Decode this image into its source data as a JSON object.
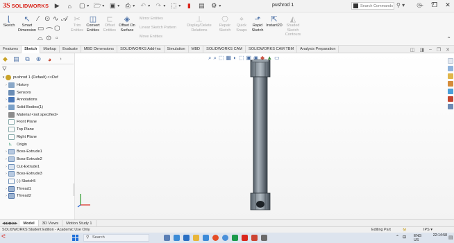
{
  "app": {
    "logo": {
      "mark": "3S",
      "name": "SOLIDWORKS",
      "mark_color": "#d9261c"
    },
    "document_title": "pushrod 1",
    "search_placeholder": "Search Commands"
  },
  "ribbon": {
    "sketch_label": "Sketch",
    "smart_dimension_label": "Smart Dimension",
    "trim_label": "Trim Entities",
    "convert_label": "Convert Entities",
    "offset_entities_label": "Offset Entities",
    "offset_on_surface_label": "Offset On Surface",
    "mirror_label": "Mirror Entities",
    "linear_pattern_label": "Linear Sketch Pattern",
    "move_label": "Move Entities",
    "display_delete_label": "Display/Delete Relations",
    "repair_label": "Repair Sketch",
    "quick_snaps_label": "Quick Snaps",
    "rapid_sketch_label": "Rapid Sketch",
    "instant2d_label": "Instant2D",
    "shaded_contours_label": "Shaded Sketch Contours"
  },
  "tabs": [
    {
      "label": "Features"
    },
    {
      "label": "Sketch"
    },
    {
      "label": "Markup"
    },
    {
      "label": "Evaluate"
    },
    {
      "label": "MBD Dimensions"
    },
    {
      "label": "SOLIDWORKS Add-Ins"
    },
    {
      "label": "Simulation"
    },
    {
      "label": "MBD"
    },
    {
      "label": "SOLIDWORKS CAM"
    },
    {
      "label": "SOLIDWORKS CAM TBM"
    },
    {
      "label": "Analysis Preparation"
    }
  ],
  "tree": {
    "root": "pushrod 1 (Default) <<Def",
    "items": [
      {
        "label": "History",
        "icon": "folder"
      },
      {
        "label": "Sensors",
        "icon": "sensor"
      },
      {
        "label": "Annotations",
        "icon": "annot"
      },
      {
        "label": "Solid Bodies(1)",
        "icon": "solid"
      },
      {
        "label": "Material <not specified>",
        "icon": "material"
      },
      {
        "label": "Front Plane",
        "icon": "plane"
      },
      {
        "label": "Top Plane",
        "icon": "plane"
      },
      {
        "label": "Right Plane",
        "icon": "plane"
      },
      {
        "label": "Origin",
        "icon": "origin"
      },
      {
        "label": "Boss-Extrude1",
        "icon": "feat"
      },
      {
        "label": "Boss-Extrude2",
        "icon": "feat"
      },
      {
        "label": "Cut-Extrude1",
        "icon": "cut"
      },
      {
        "label": "Boss-Extrude3",
        "icon": "feat"
      },
      {
        "label": "(-) Sketch5",
        "icon": "sketch"
      },
      {
        "label": "Thread1",
        "icon": "thread"
      },
      {
        "label": "Thread2",
        "icon": "thread"
      }
    ]
  },
  "model_tabs": [
    {
      "label": "Model"
    },
    {
      "label": "3D Views"
    },
    {
      "label": "Motion Study 1"
    }
  ],
  "status": {
    "edition": "SOLIDWORKS Student Edition - Academic Use Only",
    "editing": "Editing Part",
    "units": "IPS"
  },
  "taskbar": {
    "search_label": "Search",
    "lang_top": "ENG",
    "lang_bottom": "US",
    "time": "22:14:58",
    "date": ""
  },
  "colors": {
    "accent": "#d9261c",
    "model": "#6f7b86",
    "tree_blue": "#4a6fa5"
  }
}
